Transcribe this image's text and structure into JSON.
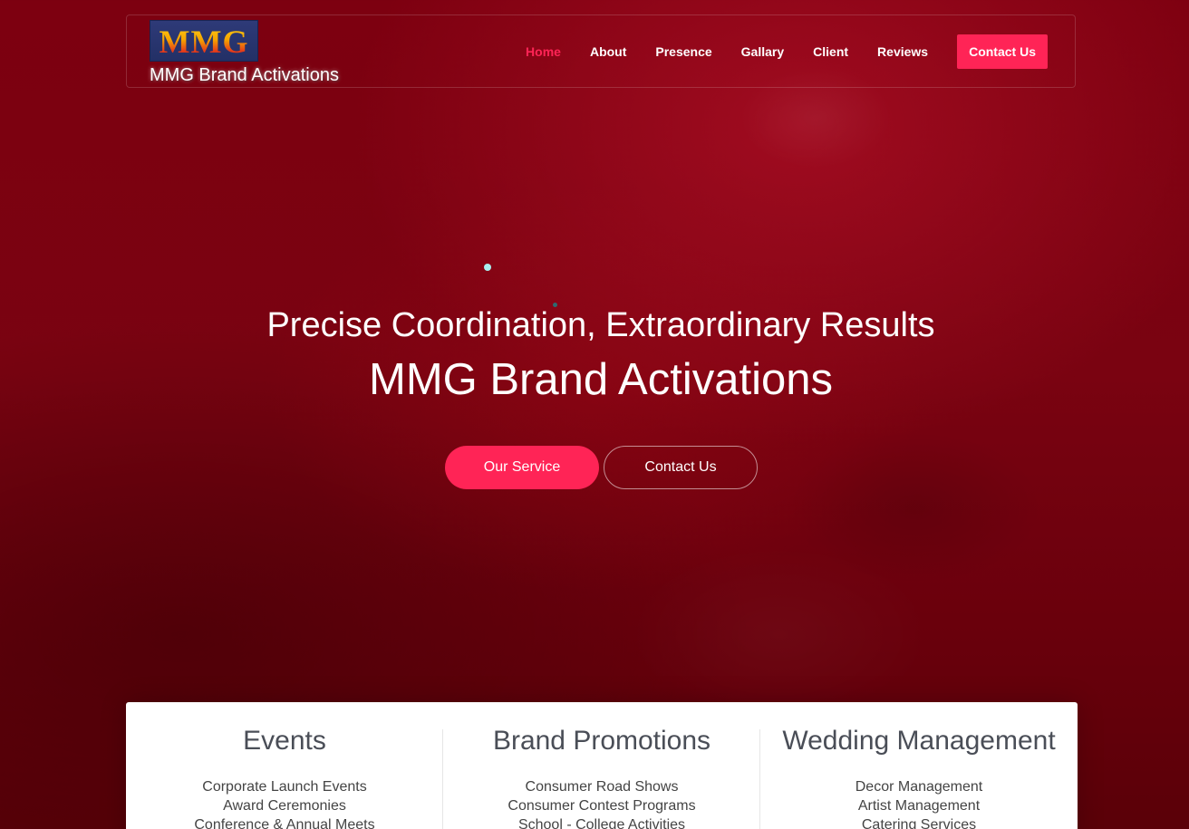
{
  "header": {
    "logo_text": "MMG",
    "brand_name": "MMG Brand Activations",
    "nav": [
      {
        "label": "Home",
        "active": true
      },
      {
        "label": "About"
      },
      {
        "label": "Presence"
      },
      {
        "label": "Gallary"
      },
      {
        "label": "Client"
      },
      {
        "label": "Reviews"
      }
    ],
    "cta_label": "Contact Us"
  },
  "hero": {
    "subtitle": "Precise Coordination, Extraordinary Results",
    "title": "MMG Brand Activations",
    "primary_button": "Our Service",
    "secondary_button": "Contact Us"
  },
  "services": [
    {
      "title": "Events",
      "items": [
        "Corporate Launch Events",
        "Award Ceremonies",
        "Conference & Annual Meets"
      ]
    },
    {
      "title": "Brand Promotions",
      "items": [
        "Consumer Road Shows",
        "Consumer Contest Programs",
        "School - College Activities"
      ]
    },
    {
      "title": "Wedding Management",
      "items": [
        "Decor Management",
        "Artist Management",
        "Catering Services"
      ]
    }
  ],
  "colors": {
    "accent": "#ff2456",
    "background": "#7a0311"
  }
}
